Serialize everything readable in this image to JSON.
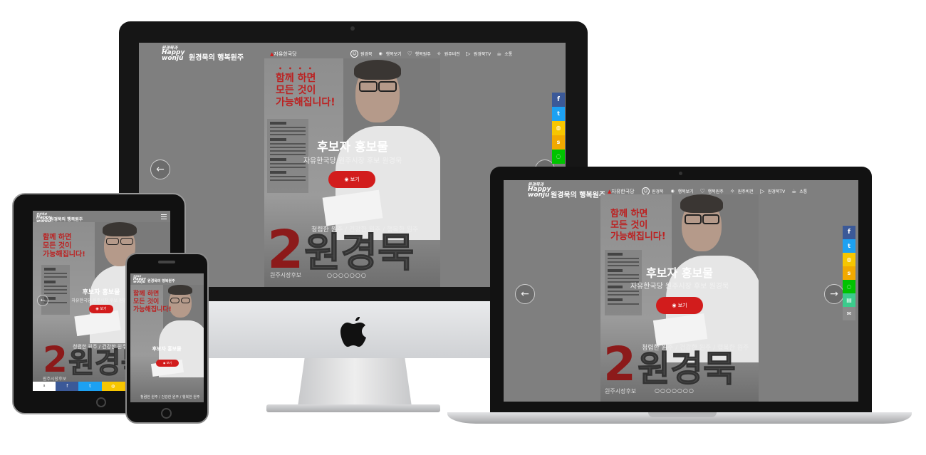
{
  "site": {
    "logo_top": "원경묵과",
    "logo_main": "Happy",
    "logo_bottom": "wonju",
    "title": "원경묵의 행복원주",
    "party": "자유한국당"
  },
  "menu": [
    {
      "label": "원경묵",
      "icon": "smile-icon",
      "glyph": "☺"
    },
    {
      "label": "행복보기",
      "icon": "eye-icon",
      "glyph": "◉"
    },
    {
      "label": "행복원주",
      "icon": "heart-icon",
      "glyph": "♡"
    },
    {
      "label": "원주비전",
      "icon": "magic-wand-icon",
      "glyph": "✧"
    },
    {
      "label": "원경묵TV",
      "icon": "play-icon",
      "glyph": "▷"
    },
    {
      "label": "소통",
      "icon": "coffee-cup-icon",
      "glyph": "☕"
    }
  ],
  "hero": {
    "dots": "• • • •",
    "slogan_1": "함께 하면",
    "slogan_2": "모든 것이",
    "slogan_3": "가능해집니다!",
    "title": "후보자 홍보물",
    "subtitle": "자유한국당 원주시장 후보 원경묵",
    "button": "보기",
    "button_icon": "◉",
    "sub_slogan": "청렴한 원주 / 건강한 원주 / 행복한 원주",
    "number": "2",
    "name": "원경묵",
    "role": "원주시장후보",
    "pager": "○○○○○○○",
    "prev": "←",
    "next": "→"
  },
  "share": [
    {
      "name": "facebook",
      "icon": "facebook-icon",
      "glyph": "f",
      "color": "#3b5998"
    },
    {
      "name": "twitter",
      "icon": "twitter-icon",
      "glyph": "t",
      "color": "#1da1f2"
    },
    {
      "name": "kakaotalk",
      "icon": "kakaotalk-icon",
      "glyph": "◍",
      "color": "#f7c600"
    },
    {
      "name": "kakaostory",
      "icon": "kakaostory-icon",
      "glyph": "s",
      "color": "#f2a900"
    },
    {
      "name": "line",
      "icon": "line-icon",
      "glyph": "◌",
      "color": "#00c300"
    },
    {
      "name": "sms",
      "icon": "sms-icon",
      "glyph": "▤",
      "color": "#3ccb8c"
    },
    {
      "name": "email",
      "icon": "email-icon",
      "glyph": "✉",
      "color": "#8a8a8a"
    }
  ],
  "colors": {
    "accent": "#d21c1c",
    "slogan": "#b22222",
    "overlay": "#7f7f7f"
  }
}
